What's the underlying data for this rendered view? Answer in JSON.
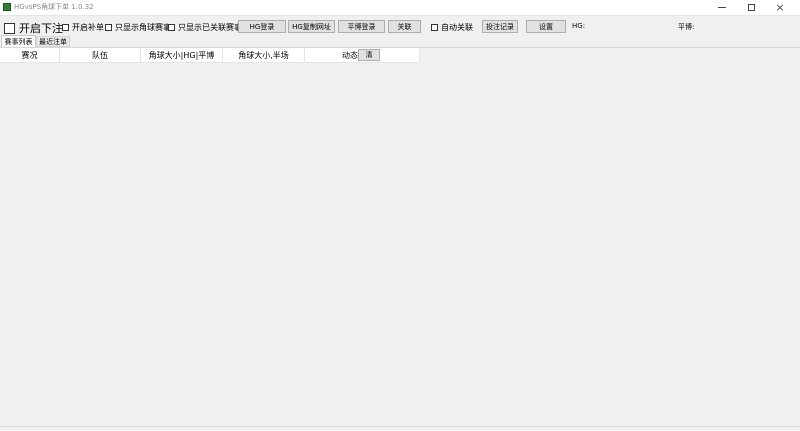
{
  "window": {
    "title": "HGvsPS角球下单 1.0.32"
  },
  "toolbar": {
    "enable_bet_label": "开启下注",
    "enable_supplement_label": "开启补单",
    "only_corner_label": "只显示角球赛事",
    "only_linked_label": "只显示已关联赛事",
    "hg_login_label": "HG登录",
    "hg_copy_url_label": "HG复制网址",
    "pb_login_label": "平博登录",
    "link_label": "关联",
    "auto_link_label": "自动关联",
    "bet_records_label": "投注记录",
    "settings_label": "设置",
    "hg_status_label": "HG:",
    "pb_status_label": "平博:"
  },
  "tabs": [
    {
      "label": "赛事列表",
      "active": true
    },
    {
      "label": "最近注单",
      "active": false
    }
  ],
  "table": {
    "columns": [
      "赛况",
      "队伍",
      "角球大小|HG|平博",
      "角球大小,半场",
      "动态"
    ],
    "clear_label": "清"
  }
}
